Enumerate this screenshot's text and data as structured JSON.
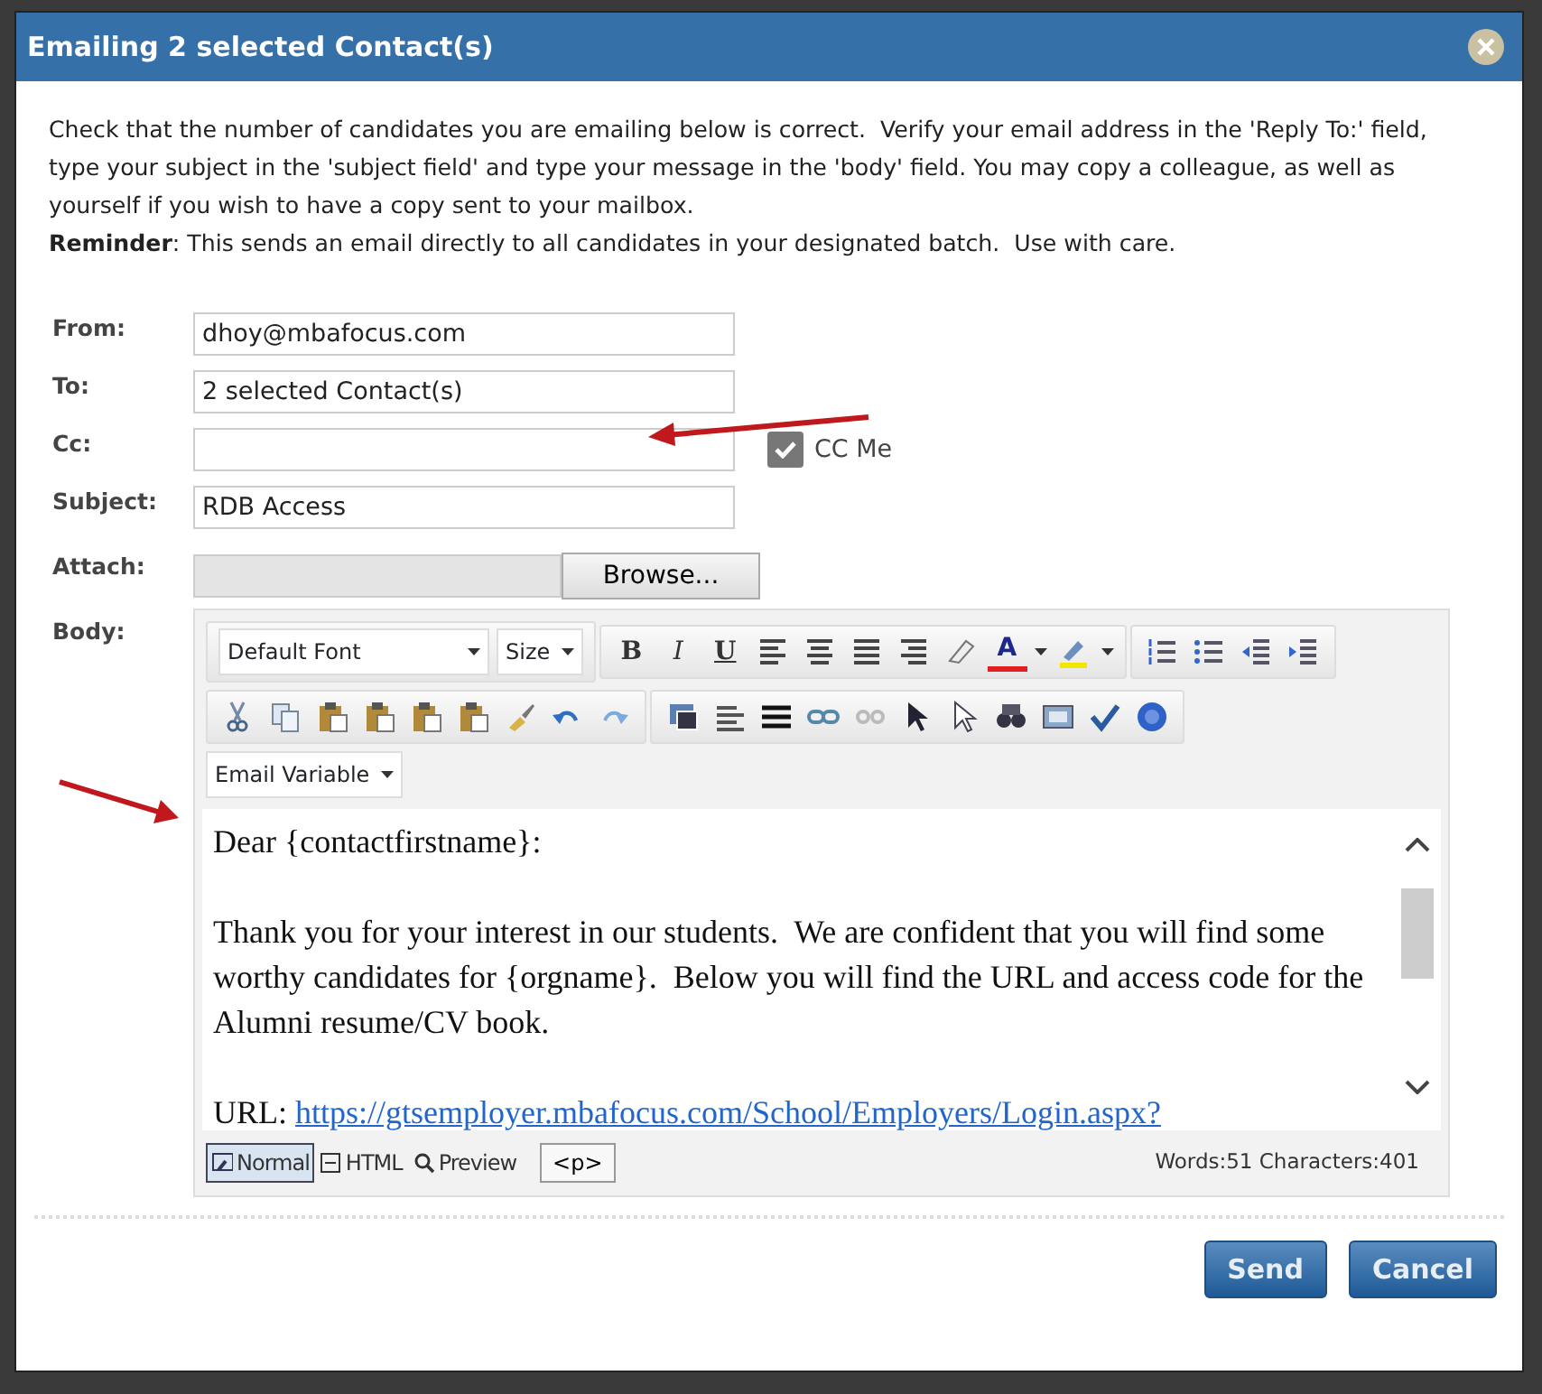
{
  "dialog": {
    "title": "Emailing 2 selected Contact(s)"
  },
  "intro": {
    "text": "Check that the number of candidates you are emailing below is correct.  Verify your email address in the 'Reply To:' field, type your subject in the 'subject field' and type your message in the 'body' field. You may copy a colleague, as well as yourself if you wish to have a copy sent to your mailbox.",
    "reminder": "**Reminder**: This sends an email directly to all candidates in your designated batch.  Use with care."
  },
  "fields": [
    {
      "label": "From:",
      "value": "dhoy@mbafocus.com"
    },
    {
      "label": "To:",
      "value": "2 selected Contact(s)"
    },
    {
      "label": "Cc:"
    },
    {
      "label": "Subject:",
      "value": "RDB Access"
    }
  ],
  "cc_me": {
    "label": "CC Me",
    "checked": true
  },
  "attach": {
    "label": "Attach:",
    "button": "Browse..."
  },
  "body": {
    "label": "Body:",
    "toolbar": {
      "font": "Default Font",
      "size": "Size",
      "format_buttons": [
        "B",
        "I",
        "U"
      ],
      "font_color": "A",
      "email_variable": "Email Variable"
    },
    "paragraphs": [
      "Dear {contactfirstname}:",
      "Thank you for your interest in our students.  We are confident that you will find some worthy candidates for {orgname}.  Below you will find the URL and access code for the Alumni resume/CV book."
    ],
    "url_label": "URL:",
    "url": "https://gtsemployer.mbafocus.com/School/Employers/Login.aspx?",
    "modes": [
      {
        "label": "Normal",
        "selected": true
      },
      {
        "label": "HTML",
        "selected": false
      },
      {
        "label": "Preview",
        "selected": false
      }
    ],
    "tag": "<p>",
    "stats": "Words:51 Characters:401"
  },
  "buttons": [
    "Send",
    "Cancel"
  ]
}
